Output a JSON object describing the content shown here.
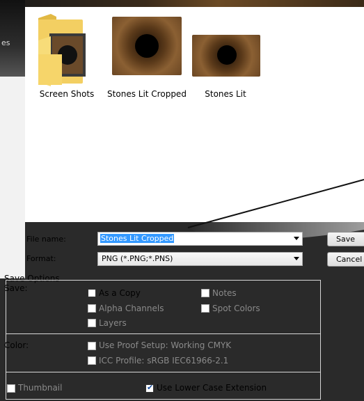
{
  "background": {
    "left_text": "es"
  },
  "files": [
    {
      "label": "Screen Shots",
      "icon": "folder-icon"
    },
    {
      "label": "Stones Lit Cropped",
      "icon": "image-thumbnail-icon"
    },
    {
      "label": "Stones Lit",
      "icon": "image-thumbnail-icon"
    }
  ],
  "fields": {
    "filename_label": "File name:",
    "filename_value": "Stones Lit Cropped",
    "format_label": "Format:",
    "format_value": "PNG (*.PNG;*.PNS)"
  },
  "buttons": {
    "save": "Save",
    "cancel": "Cancel"
  },
  "options": {
    "title": "Save Options",
    "save_label": "Save:",
    "as_copy": "As a Copy",
    "notes": "Notes",
    "alpha_channels": "Alpha Channels",
    "spot_colors": "Spot Colors",
    "layers": "Layers",
    "color_label": "Color:",
    "proof_setup": "Use Proof Setup:  Working CMYK",
    "icc_profile": "ICC Profile:  sRGB IEC61966-2.1",
    "thumbnail": "Thumbnail",
    "lower_case": "Use Lower Case Extension"
  },
  "colors": {
    "selection": "#3399ff",
    "accent_border": "#8e8e8e"
  }
}
